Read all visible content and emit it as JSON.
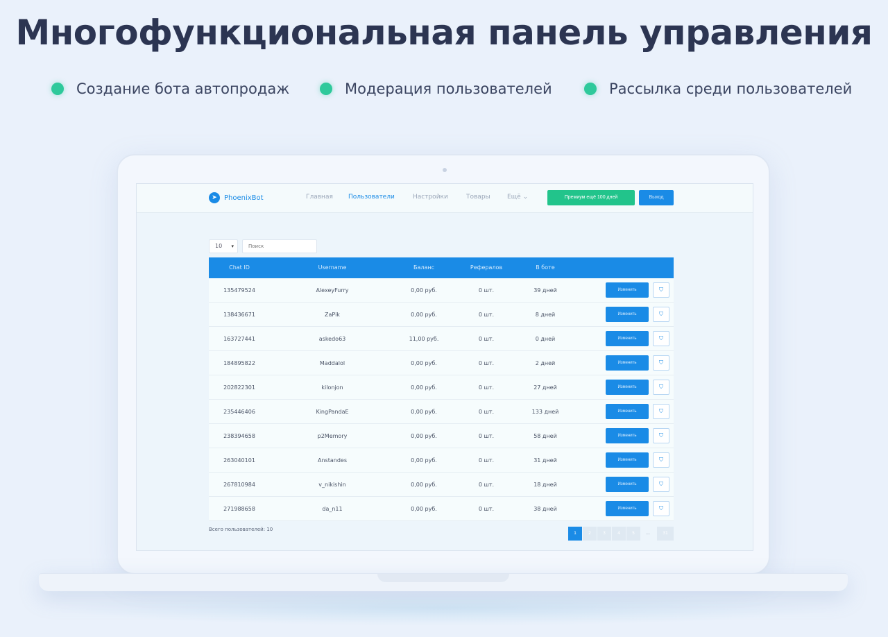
{
  "headline": "Многофункциональная панель управления",
  "features": [
    {
      "label": "Создание бота автопродаж"
    },
    {
      "label": "Модерация пользователей"
    },
    {
      "label": "Рассылка среди пользователей"
    }
  ],
  "colors": {
    "accent": "#1a8be6",
    "green": "#22c48b",
    "dot": "#2ec99b"
  },
  "app": {
    "brand": "PhoenixBot",
    "nav": [
      "Главная",
      "Пользователи",
      "Настройки",
      "Товары",
      "Ещё"
    ],
    "premium_label": "Премиум ещё 100 дней",
    "logout_label": "Выход",
    "per_page": "10",
    "search_placeholder": "Поиск",
    "columns": [
      "Chat ID",
      "Username",
      "Баланс",
      "Рефералов",
      "В боте"
    ],
    "edit_label": "Изменить",
    "rows": [
      {
        "chat_id": "135479524",
        "username": "AlexeyFurry",
        "balance": "0,00 руб.",
        "referrals": "0 шт.",
        "in_bot": "39 дней"
      },
      {
        "chat_id": "138436671",
        "username": "ZaPik",
        "balance": "0,00 руб.",
        "referrals": "0 шт.",
        "in_bot": "8 дней"
      },
      {
        "chat_id": "163727441",
        "username": "askedo63",
        "balance": "11,00 руб.",
        "referrals": "0 шт.",
        "in_bot": "0 дней"
      },
      {
        "chat_id": "184895822",
        "username": "Maddalol",
        "balance": "0,00 руб.",
        "referrals": "0 шт.",
        "in_bot": "2 дней"
      },
      {
        "chat_id": "202822301",
        "username": "kilonjon",
        "balance": "0,00 руб.",
        "referrals": "0 шт.",
        "in_bot": "27 дней"
      },
      {
        "chat_id": "235446406",
        "username": "KingPandaE",
        "balance": "0,00 руб.",
        "referrals": "0 шт.",
        "in_bot": "133 дней"
      },
      {
        "chat_id": "238394658",
        "username": "p2Memory",
        "balance": "0,00 руб.",
        "referrals": "0 шт.",
        "in_bot": "58 дней"
      },
      {
        "chat_id": "263040101",
        "username": "Anstandes",
        "balance": "0,00 руб.",
        "referrals": "0 шт.",
        "in_bot": "31 дней"
      },
      {
        "chat_id": "267810984",
        "username": "v_nikishin",
        "balance": "0,00 руб.",
        "referrals": "0 шт.",
        "in_bot": "18 дней"
      },
      {
        "chat_id": "271988658",
        "username": "da_n11",
        "balance": "0,00 руб.",
        "referrals": "0 шт.",
        "in_bot": "38 дней"
      }
    ],
    "total_label": "Всего пользователей: 10",
    "pages": [
      "1",
      "2",
      "3",
      "4",
      "5",
      "...",
      "31"
    ]
  }
}
